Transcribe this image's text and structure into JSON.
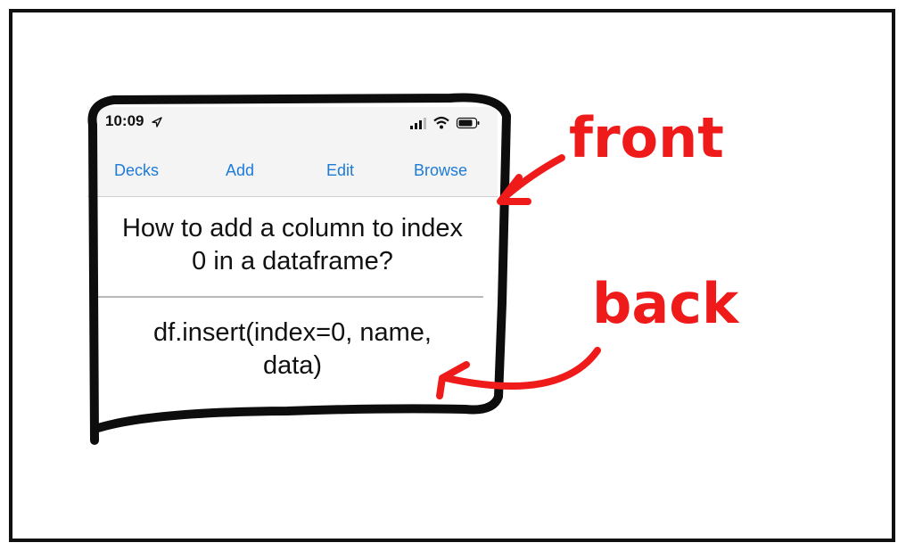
{
  "status_bar": {
    "time": "10:09"
  },
  "navbar": {
    "decks": "Decks",
    "add": "Add",
    "edit": "Edit",
    "browse": "Browse"
  },
  "card": {
    "front_line1": "How to add a column to index",
    "front_line2": "0 in a dataframe?",
    "back_line1": "df.insert(index=0, name,",
    "back_line2": "data)"
  },
  "annotations": {
    "front_label": "front",
    "back_label": "back"
  },
  "colors": {
    "ios_blue": "#1d7bd8",
    "annotation_red": "#ef1b1b",
    "bar_gray": "#f4f4f4"
  },
  "icons": [
    "location-arrow-icon",
    "signal-bars-icon",
    "wifi-icon",
    "battery-icon"
  ]
}
